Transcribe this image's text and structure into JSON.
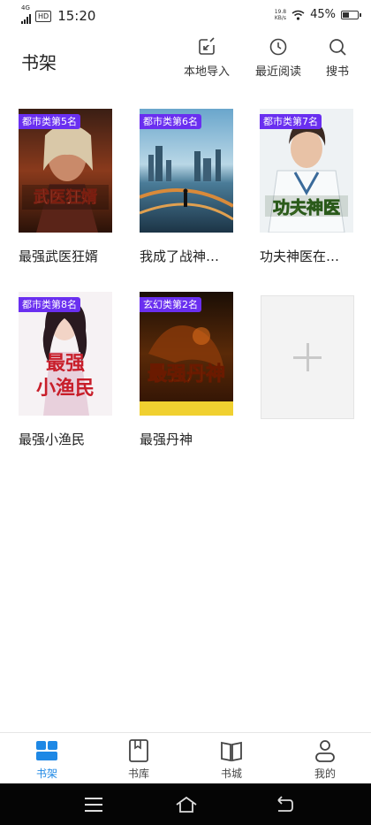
{
  "status_bar": {
    "network": "4G",
    "hd": "HD",
    "time": "15:20",
    "speed_value": "19.8",
    "speed_unit": "KB/s",
    "battery_percent": "45%",
    "battery_level": 0.45
  },
  "header": {
    "title": "书架",
    "actions": [
      {
        "label": "本地导入",
        "icon": "import-icon"
      },
      {
        "label": "最近阅读",
        "icon": "clock-icon"
      },
      {
        "label": "搜书",
        "icon": "search-icon"
      }
    ]
  },
  "books": [
    {
      "title": "最强武医狂婿",
      "badge": "都市类第5名",
      "cover_text": "武医狂婿"
    },
    {
      "title": "我成了战神…",
      "badge": "都市类第6名",
      "cover_text": ""
    },
    {
      "title": "功夫神医在…",
      "badge": "都市类第7名",
      "cover_text": "功夫神医"
    },
    {
      "title": "最强小渔民",
      "badge": "都市类第8名",
      "cover_text": "最强小渔民"
    },
    {
      "title": "最强丹神",
      "badge": "玄幻类第2名",
      "cover_text": "最强丹神"
    }
  ],
  "tabs": [
    {
      "label": "书架",
      "active": true
    },
    {
      "label": "书库",
      "active": false
    },
    {
      "label": "书城",
      "active": false
    },
    {
      "label": "我的",
      "active": false
    }
  ],
  "colors": {
    "accent": "#1e88e5",
    "badge": "#6a2ff0"
  }
}
